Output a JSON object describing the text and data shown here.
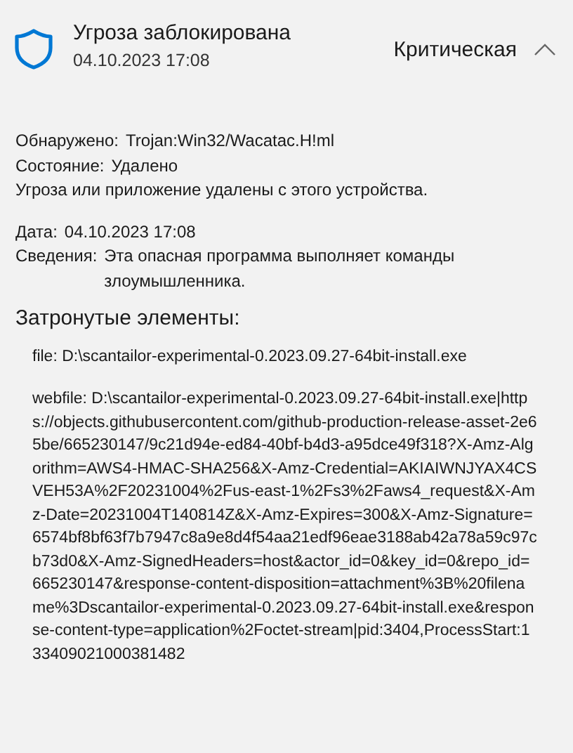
{
  "header": {
    "title": "Угроза заблокирована",
    "time": "04.10.2023 17:08",
    "severity": "Критическая",
    "expanded": true
  },
  "summary": [
    {
      "label": "Обнаружено:",
      "value": "Trojan:Win32/Wacatac.H!ml"
    },
    {
      "label": "Состояние:",
      "value": "Удалено"
    }
  ],
  "status_message": "Угроза или приложение удалены с этого устройства.",
  "info": [
    {
      "label": "Дата:",
      "value": "04.10.2023 17:08"
    },
    {
      "label": "Сведения:",
      "value": "Эта опасная программа выполняет команды злоумышленника."
    }
  ],
  "affected_title": "Затронутые элементы:",
  "affected_items": [
    "file: D:\\scantailor-experimental-0.2023.09.27-64bit-install.exe",
    "webfile: D:\\scantailor-experimental-0.2023.09.27-64bit-install.exe|https://objects.githubusercontent.com/github-production-release-asset-2e65be/665230147/9c21d94e-ed84-40bf-b4d3-a95dce49f318?X-Amz-Algorithm=AWS4-HMAC-SHA256&X-Amz-Credential=AKIAIWNJYAX4CSVEH53A%2F20231004%2Fus-east-1%2Fs3%2Faws4_request&X-Amz-Date=20231004T140814Z&X-Amz-Expires=300&X-Amz-Signature=6574bf8bf63f7b7947c8a9e8d4f54aa21edf96eae3188ab42a78a59c97cb73d0&X-Amz-SignedHeaders=host&actor_id=0&key_id=0&repo_id=665230147&response-content-disposition=attachment%3B%20filename%3Dscantailor-experimental-0.2023.09.27-64bit-install.exe&response-content-type=application%2Foctet-stream|pid:3404,ProcessStart:133409021000381482"
  ]
}
